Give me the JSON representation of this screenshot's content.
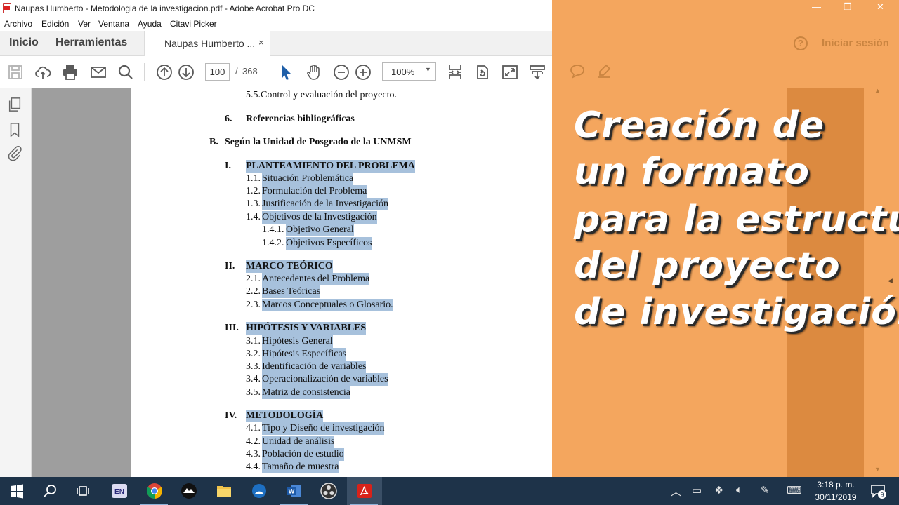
{
  "window": {
    "title": "Naupas Humberto - Metodologia de la investigacion.pdf - Adobe Acrobat Pro DC",
    "minimize": "—",
    "maximize": "❐",
    "close": "✕"
  },
  "menu": [
    "Archivo",
    "Edición",
    "Ver",
    "Ventana",
    "Ayuda",
    "Citavi Picker"
  ],
  "tabs": {
    "home": "Inicio",
    "tools": "Herramientas",
    "document": "Naupas Humberto ...",
    "close": "×"
  },
  "account": {
    "help": "?",
    "signin": "Iniciar sesión"
  },
  "toolbar": {
    "current_page": "100",
    "separator": "/",
    "total_pages": "368",
    "zoom": "100%",
    "zoom_caret": "▼"
  },
  "document": {
    "lines": [
      {
        "text": "5.5.Control y evaluación del proyecto.",
        "highlight": false,
        "bold": false
      },
      {
        "text": "6.",
        "highlight": false,
        "bold": true
      },
      {
        "text": "Referencias bibliográficas",
        "highlight": false,
        "bold": true
      },
      {
        "text": "B.",
        "highlight": false,
        "bold": true
      },
      {
        "text": "Según la Unidad de Posgrado de la UNMSM",
        "highlight": false,
        "bold": true
      },
      {
        "text": "I.",
        "highlight": false,
        "bold": true
      },
      {
        "text": "PLANTEAMIENTO DEL PROBLEMA",
        "highlight": true,
        "bold": true
      },
      {
        "text": "1.1.",
        "highlight": false,
        "bold": false
      },
      {
        "text": "Situación Problemática",
        "highlight": true,
        "bold": false
      },
      {
        "text": "1.2.",
        "highlight": false,
        "bold": false
      },
      {
        "text": "Formulación del Problema",
        "highlight": true,
        "bold": false
      },
      {
        "text": "1.3.",
        "highlight": false,
        "bold": false
      },
      {
        "text": "Justificación de la Investigación",
        "highlight": true,
        "bold": false
      },
      {
        "text": "1.4.",
        "highlight": false,
        "bold": false
      },
      {
        "text": "Objetivos de la Investigación",
        "highlight": true,
        "bold": false
      },
      {
        "text": "1.4.1.",
        "highlight": false,
        "bold": false
      },
      {
        "text": "Objetivo General",
        "highlight": true,
        "bold": false
      },
      {
        "text": "1.4.2.",
        "highlight": false,
        "bold": false
      },
      {
        "text": "Objetivos Específicos",
        "highlight": true,
        "bold": false
      },
      {
        "text": "II.",
        "highlight": false,
        "bold": true
      },
      {
        "text": "MARCO TEÓRICO",
        "highlight": true,
        "bold": true
      },
      {
        "text": "2.1.",
        "highlight": false,
        "bold": false
      },
      {
        "text": "Antecedentes del Problema",
        "highlight": true,
        "bold": false
      },
      {
        "text": "2.2.",
        "highlight": false,
        "bold": false
      },
      {
        "text": "Bases Teóricas",
        "highlight": true,
        "bold": false
      },
      {
        "text": "2.3.",
        "highlight": false,
        "bold": false
      },
      {
        "text": "Marcos Conceptuales o Glosario.",
        "highlight": true,
        "bold": false
      },
      {
        "text": "III.",
        "highlight": false,
        "bold": true
      },
      {
        "text": "HIPÓTESIS Y VARIABLES",
        "highlight": true,
        "bold": true
      },
      {
        "text": "3.1.",
        "highlight": false,
        "bold": false
      },
      {
        "text": "Hipótesis General",
        "highlight": true,
        "bold": false
      },
      {
        "text": "3.2.",
        "highlight": false,
        "bold": false
      },
      {
        "text": "Hipótesis Específicas",
        "highlight": true,
        "bold": false
      },
      {
        "text": "3.3.",
        "highlight": false,
        "bold": false
      },
      {
        "text": "Identificación de variables",
        "highlight": true,
        "bold": false
      },
      {
        "text": "3.4.",
        "highlight": false,
        "bold": false
      },
      {
        "text": "Operacionalización de variables",
        "highlight": true,
        "bold": false
      },
      {
        "text": "3.5.",
        "highlight": false,
        "bold": false
      },
      {
        "text": "Matriz de consistencia",
        "highlight": true,
        "bold": false
      },
      {
        "text": "IV.",
        "highlight": false,
        "bold": true
      },
      {
        "text": "METODOLOGÍA",
        "highlight": true,
        "bold": true
      },
      {
        "text": "4.1.",
        "highlight": false,
        "bold": false
      },
      {
        "text": "Tipo y Diseño de investigación",
        "highlight": true,
        "bold": false
      },
      {
        "text": "4.2.",
        "highlight": false,
        "bold": false
      },
      {
        "text": "Unidad de análisis",
        "highlight": true,
        "bold": false
      },
      {
        "text": "4.3.",
        "highlight": false,
        "bold": false
      },
      {
        "text": "Población de estudio",
        "highlight": true,
        "bold": false
      },
      {
        "text": "4.4.",
        "highlight": false,
        "bold": false
      },
      {
        "text": "Tamaño de muestra",
        "highlight": true,
        "bold": false
      }
    ]
  },
  "headline": [
    "Creación de",
    "un formato",
    "para la estructura",
    "del  proyecto",
    "de  investigación"
  ],
  "taskbar": {
    "lang": "EN",
    "time": "3:18 p. m.",
    "date": "30/11/2019",
    "notifications": "9"
  },
  "colors": {
    "overlay": "#f4a65e",
    "overlay_stripe": "#dc8a40",
    "highlight": "#a7c1dc",
    "taskbar": "#1e3349"
  }
}
